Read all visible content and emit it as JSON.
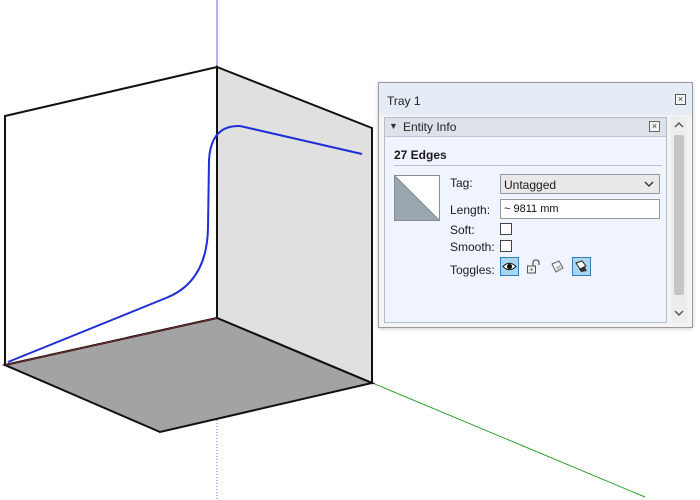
{
  "tray": {
    "title": "Tray 1",
    "close_icon": "close-icon"
  },
  "entity_info": {
    "title": "Entity Info",
    "caret_icon": "triangle-down-icon",
    "close_icon": "close-icon",
    "selection_summary": "27 Edges",
    "tag": {
      "label": "Tag:",
      "value": "Untagged"
    },
    "length": {
      "label": "Length:",
      "value": "~ 9811 mm"
    },
    "soft": {
      "label": "Soft:",
      "checked": false
    },
    "smooth": {
      "label": "Smooth:",
      "checked": false
    },
    "toggles": {
      "label": "Toggles:",
      "items": [
        {
          "icon": "eye-icon",
          "active": true
        },
        {
          "icon": "lock-icon",
          "active": false
        },
        {
          "icon": "receive-shadows-icon",
          "active": false
        },
        {
          "icon": "cast-shadows-icon",
          "active": true
        }
      ]
    }
  },
  "colors": {
    "accent_blue": "#1f2fd6",
    "axis_red": "#c03030",
    "axis_green": "#2fa02f",
    "axis_blue": "#6a6ae0",
    "face_gray": "#a3a3a3",
    "face_light": "#e0e0e0"
  }
}
